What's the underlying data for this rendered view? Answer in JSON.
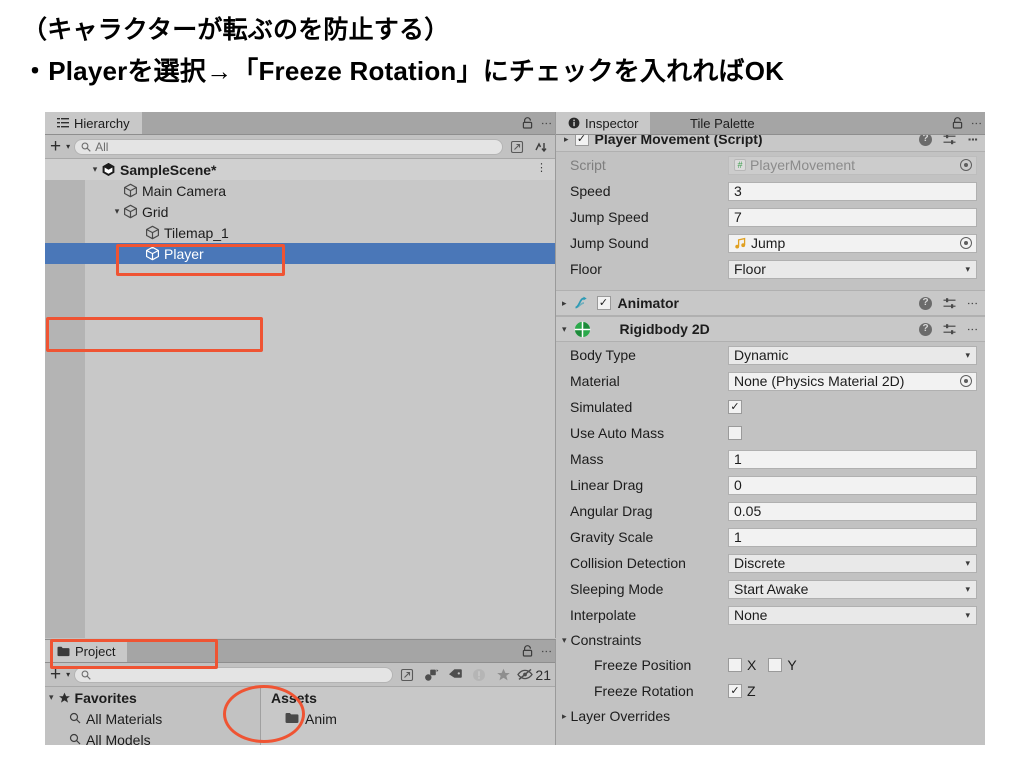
{
  "caption": {
    "line1": "（キャラクターが転ぶのを防止する）",
    "line2": "・Playerを選択→「Freeze Rotation」にチェックを入れればOK"
  },
  "colors": {
    "annotation": "#ef5433",
    "selection": "#4a77b8",
    "panel_bg": "#c2c2c2",
    "rigidbody_icon_green": "#2aa94a",
    "animator_icon_teal": "#2e9bb5",
    "audio_icon_gold": "#e0a021"
  },
  "hierarchy": {
    "tab": {
      "label": "Hierarchy",
      "icon": "hierarchy-icon"
    },
    "tab_lock_icon": "lock-icon",
    "tab_menu_icon": "kebab-menu-icon",
    "toolbar": {
      "add_label": "+",
      "add_caret": "▾",
      "search_icon": "search-icon",
      "search_value": "All",
      "search_placeholder": "All",
      "expand_icon": "expand-window-icon",
      "sort_icon": "sort-icon"
    },
    "rows": [
      {
        "label": "SampleScene*",
        "indent": 0,
        "twisty": "▾",
        "icon": "unity-scene-icon",
        "selected": false,
        "bold": true,
        "menu": "⋮"
      },
      {
        "label": "Main Camera",
        "indent": 1,
        "twisty": "",
        "icon": "gameobject-cube-icon",
        "selected": false,
        "bold": false,
        "menu": ""
      },
      {
        "label": "Grid",
        "indent": 1,
        "twisty": "▾",
        "icon": "gameobject-cube-icon",
        "selected": false,
        "bold": false,
        "menu": ""
      },
      {
        "label": "Tilemap_1",
        "indent": 2,
        "twisty": "",
        "icon": "gameobject-cube-icon",
        "selected": false,
        "bold": false,
        "menu": ""
      },
      {
        "label": "Player",
        "indent": 2,
        "twisty": "",
        "icon": "gameobject-cube-icon",
        "selected": true,
        "bold": false,
        "menu": ""
      }
    ]
  },
  "project": {
    "tab": {
      "label": "Project",
      "icon": "folder-icon"
    },
    "tab_lock_icon": "lock-icon",
    "tab_menu_icon": "kebab-menu-icon",
    "toolbar": {
      "add_label": "+",
      "add_caret": "▾",
      "search_icon": "search-icon",
      "search_value": "",
      "search_placeholder": "",
      "expand_icon": "expand-window-icon",
      "filter_type_icon": "filter-by-type-icon",
      "filter_label_icon": "label-tag-icon",
      "filter_warning_icon": "warning-icon",
      "filter_favorite_icon": "star-icon",
      "hidden_icon": "hidden-eye-icon",
      "hidden_count": "21"
    },
    "favorites_header": "Favorites",
    "favorites": [
      {
        "label": "All Materials",
        "icon": "search-icon"
      },
      {
        "label": "All Models",
        "icon": "search-icon"
      }
    ],
    "assets_header": "Assets",
    "assets": [
      {
        "label": "Anim",
        "icon": "folder-icon"
      }
    ]
  },
  "inspector": {
    "tabs": [
      {
        "label": "Inspector",
        "icon": "info-icon",
        "active": true
      },
      {
        "label": "Tile Palette",
        "icon": "",
        "active": false
      }
    ],
    "tab_lock_icon": "lock-icon",
    "tab_menu_icon": "kebab-menu-icon",
    "clipped_component": "Player Movement (Script)",
    "script_component": {
      "rows": [
        {
          "label": "Script",
          "value": "PlayerMovement",
          "type": "object",
          "disabled": true,
          "icon": "cs-script-icon"
        },
        {
          "label": "Speed",
          "value": "3",
          "type": "text",
          "disabled": false,
          "icon": ""
        },
        {
          "label": "Jump Speed",
          "value": "7",
          "type": "text",
          "disabled": false,
          "icon": ""
        },
        {
          "label": "Jump Sound",
          "value": "Jump",
          "type": "object",
          "disabled": false,
          "icon": "audio-clip-icon"
        },
        {
          "label": "Floor",
          "value": "Floor",
          "type": "dropdown",
          "disabled": false,
          "icon": ""
        }
      ]
    },
    "animator": {
      "title": "Animator",
      "foldout": "▸",
      "icon": "animator-icon",
      "enabled_check": "✓",
      "help_icon": "help-icon",
      "preset_icon": "preset-sliders-icon",
      "menu_icon": "kebab-menu-icon"
    },
    "rigidbody": {
      "title": "Rigidbody 2D",
      "foldout": "▾",
      "icon": "rigidbody2d-icon",
      "help_icon": "help-icon",
      "preset_icon": "preset-sliders-icon",
      "menu_icon": "kebab-menu-icon",
      "rows": [
        {
          "label": "Body Type",
          "value": "Dynamic",
          "type": "dropdown"
        },
        {
          "label": "Material",
          "value": "None (Physics Material 2D)",
          "type": "object"
        },
        {
          "label": "Simulated",
          "value": "✓",
          "type": "checkbox"
        },
        {
          "label": "Use Auto Mass",
          "value": "",
          "type": "checkbox"
        },
        {
          "label": "Mass",
          "value": "1",
          "type": "text"
        },
        {
          "label": "Linear Drag",
          "value": "0",
          "type": "text"
        },
        {
          "label": "Angular Drag",
          "value": "0.05",
          "type": "text"
        },
        {
          "label": "Gravity Scale",
          "value": "1",
          "type": "text"
        },
        {
          "label": "Collision Detection",
          "value": "Discrete",
          "type": "dropdown"
        },
        {
          "label": "Sleeping Mode",
          "value": "Start Awake",
          "type": "dropdown"
        },
        {
          "label": "Interpolate",
          "value": "None",
          "type": "dropdown"
        }
      ],
      "constraints": {
        "label": "Constraints",
        "foldout": "▾",
        "freeze_position": {
          "label": "Freeze Position",
          "axes": [
            {
              "axis": "X",
              "checked": ""
            },
            {
              "axis": "Y",
              "checked": ""
            }
          ]
        },
        "freeze_rotation": {
          "label": "Freeze Rotation",
          "axes": [
            {
              "axis": "Z",
              "checked": "✓"
            }
          ]
        }
      },
      "layer_overrides": {
        "label": "Layer Overrides",
        "foldout": "▸"
      }
    }
  },
  "annotations": [
    {
      "name": "player-row-highlight",
      "shape": "rect"
    },
    {
      "name": "rigidbody-header-highlight",
      "shape": "rect"
    },
    {
      "name": "constraints-highlight",
      "shape": "rect"
    },
    {
      "name": "freeze-rotation-highlight",
      "shape": "ellipse"
    }
  ]
}
